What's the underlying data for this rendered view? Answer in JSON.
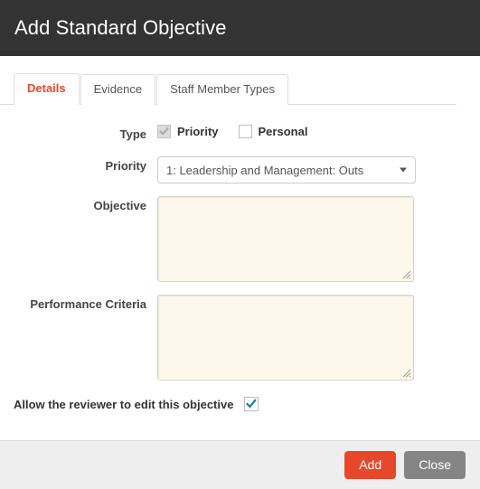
{
  "dialog": {
    "title": "Add Standard Objective"
  },
  "tabs": [
    {
      "label": "Details",
      "active": true
    },
    {
      "label": "Evidence",
      "active": false
    },
    {
      "label": "Staff Member Types",
      "active": false
    }
  ],
  "form": {
    "type": {
      "label": "Type",
      "options": [
        {
          "label": "Priority",
          "checked": true,
          "disabled": true
        },
        {
          "label": "Personal",
          "checked": false,
          "disabled": false
        }
      ]
    },
    "priority": {
      "label": "Priority",
      "value": "1: Leadership and Management: Outs",
      "caret_icon": "chevron-down-icon"
    },
    "objective": {
      "label": "Objective",
      "value": "",
      "placeholder": ""
    },
    "performance_criteria": {
      "label": "Performance Criteria",
      "value": "",
      "placeholder": ""
    },
    "allow_reviewer": {
      "label": "Allow the reviewer to edit this objective",
      "checked": true
    }
  },
  "footer": {
    "add_label": "Add",
    "close_label": "Close"
  },
  "colors": {
    "header_bg": "#333333",
    "accent": "#e8482a",
    "footer_bg": "#eeeeee",
    "textarea_bg": "#fdf8eb",
    "checkbox_blue": "#1a7cad",
    "close_btn": "#858585"
  }
}
